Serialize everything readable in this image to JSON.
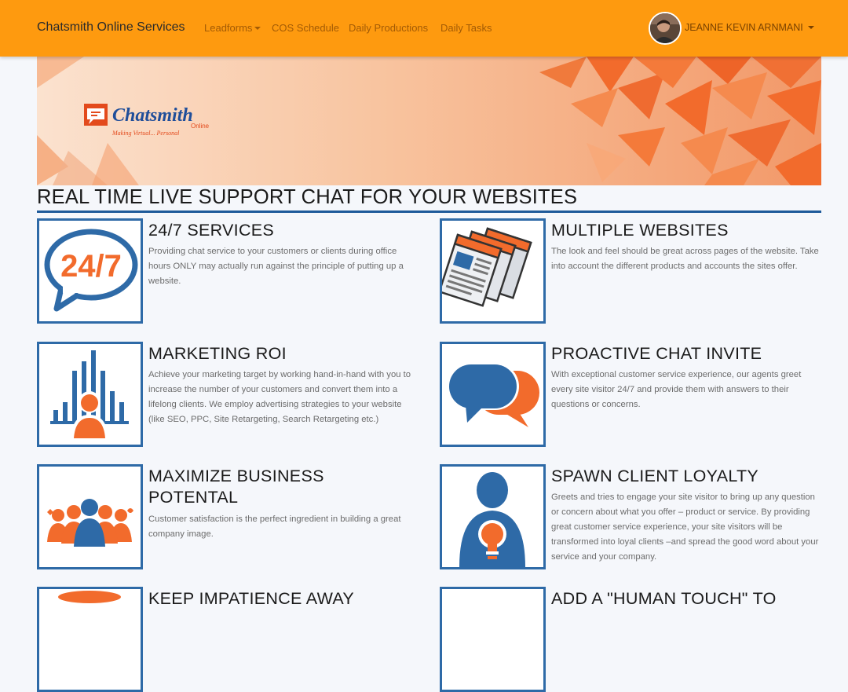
{
  "navbar": {
    "brand": "Chatsmith Online Services",
    "links": [
      "Leadforms",
      "COS Schedule",
      "Daily Productions",
      "Daily Tasks"
    ],
    "user": "JEANNE KEVIN ARNMANI"
  },
  "banner": {
    "logo_text": "Chatsmith",
    "logo_sub": "Online",
    "tagline": "Making Virtual... Personal"
  },
  "heading": "REAL TIME LIVE SUPPORT CHAT FOR YOUR WEBSITES",
  "features": [
    {
      "title": "24/7 SERVICES",
      "icon": "24-7-chat-icon",
      "icon_text": "24/7",
      "desc": "Providing chat service to your customers or clients during office hours ONLY may actually run against the principle of putting up a website."
    },
    {
      "title": "MULTIPLE WEBSITES",
      "icon": "multiple-windows-icon",
      "desc": "The look and feel should be great across pages of the website. Take into account the different products and accounts the sites offer."
    },
    {
      "title": "MARKETING ROI",
      "icon": "marketing-roi-icon",
      "desc": "Achieve your marketing target by working hand-in-hand with you to increase the number of your customers and convert them into a lifelong clients. We employ advertising strategies to your website (like SEO, PPC, Site Retargeting, Search Retargeting etc.)"
    },
    {
      "title": "PROACTIVE CHAT INVITE",
      "icon": "chat-bubbles-icon",
      "desc": "With exceptional customer service experience, our agents greet every site visitor 24/7 and provide them with answers to their questions or concerns."
    },
    {
      "title": "MAXIMIZE BUSINESS POTENTAL",
      "icon": "team-icon",
      "desc": "Customer satisfaction is the perfect ingredient in building a great company image."
    },
    {
      "title": "SPAWN CLIENT LOYALTY",
      "icon": "person-idea-icon",
      "desc": "Greets and tries to engage your site visitor to bring up any question or concern about what you offer – product or service. By providing great customer service experience, your site visitors will be transformed into loyal clients –and spread the good word about your service and your company."
    },
    {
      "title": "KEEP IMPATIENCE AWAY",
      "icon": "partial-icon"
    },
    {
      "title": "ADD A \"HUMAN TOUCH\" TO",
      "icon": "partial-icon"
    }
  ],
  "colors": {
    "nav": "#fe9a0f",
    "accent_blue": "#2e6aa7",
    "accent_orange": "#f26b2c"
  }
}
